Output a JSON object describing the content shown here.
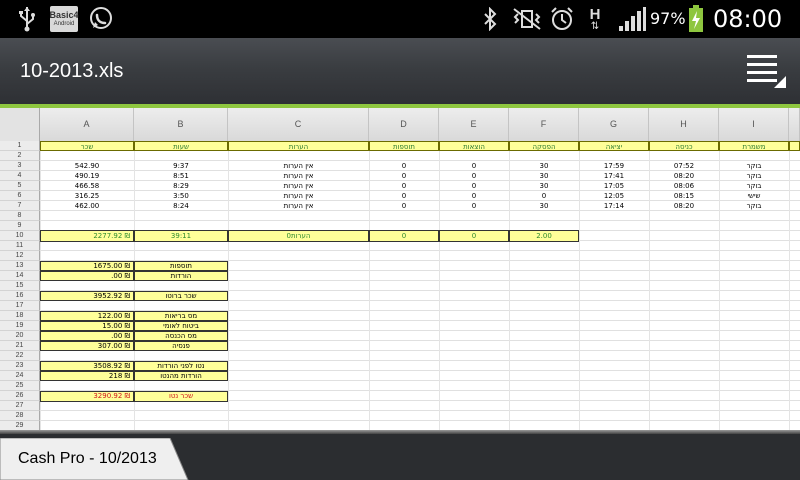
{
  "status_bar": {
    "battery_percent": "97%",
    "time": "08:00",
    "network_label": "H",
    "notification_icons": [
      "usb-icon",
      "basic-android-app-icon",
      "whatsapp-icon"
    ],
    "system_icons": [
      "bluetooth-icon",
      "vibrate-icon",
      "alarm-icon",
      "network-h-icon",
      "signal-icon",
      "battery-charging-icon"
    ],
    "app_badge_line1": "Basic4",
    "app_badge_line2": "Android"
  },
  "action_bar": {
    "file_title": "10-2013.xls",
    "menu_icon": "menu-icon",
    "accent_color": "#8ec63f"
  },
  "sheet": {
    "columns": [
      "A",
      "B",
      "C",
      "D",
      "E",
      "F",
      "G",
      "H",
      "I"
    ],
    "row_numbers": [
      "1",
      "2",
      "3",
      "4",
      "5",
      "6",
      "7",
      "8",
      "9",
      "10",
      "11",
      "12",
      "13",
      "14",
      "15",
      "16",
      "17",
      "18",
      "19",
      "20",
      "21",
      "22",
      "23",
      "24",
      "25",
      "26",
      "27",
      "28",
      "29"
    ],
    "header_row": [
      "שכר",
      "שעות",
      "הערות",
      "תוספות",
      "הוצאות",
      "הפסקה",
      "יציאה",
      "כניסה",
      "משמרת"
    ],
    "data_rows": [
      [
        "542.90",
        "9:37",
        "אין הערות",
        "0",
        "0",
        "30",
        "17:59",
        "07:52",
        "בוקר"
      ],
      [
        "490.19",
        "8:51",
        "אין הערות",
        "0",
        "0",
        "30",
        "17:41",
        "08:20",
        "בוקר"
      ],
      [
        "466.58",
        "8:29",
        "אין הערות",
        "0",
        "0",
        "30",
        "17:05",
        "08:06",
        "בוקר"
      ],
      [
        "316.25",
        "3:50",
        "אין הערות",
        "0",
        "0",
        "0",
        "12:05",
        "08:15",
        "שישי"
      ],
      [
        "462.00",
        "8:24",
        "אין הערות",
        "0",
        "0",
        "30",
        "17:14",
        "08:20",
        "בוקר"
      ]
    ],
    "totals_row": [
      "2277.92 ₪",
      "39:11",
      "0הערות",
      "0",
      "0",
      "2.00"
    ],
    "summary": [
      {
        "row": "13",
        "value": "1675.00 ₪",
        "label": "תוספות"
      },
      {
        "row": "14",
        "value": ".00 ₪",
        "label": "הורדות"
      },
      {
        "row": "16",
        "value": "3952.92 ₪",
        "label": "שכר ברוטו"
      },
      {
        "row": "18",
        "value": "122.00 ₪",
        "label": "מס בריאות"
      },
      {
        "row": "19",
        "value": "15.00 ₪",
        "label": "ביטוח לאומי"
      },
      {
        "row": "20",
        "value": ".00 ₪",
        "label": "מס הכנסה"
      },
      {
        "row": "21",
        "value": "307.00 ₪",
        "label": "פנסיה"
      },
      {
        "row": "23",
        "value": "3508.92 ₪",
        "label": "נטו לפני הורדות"
      },
      {
        "row": "24",
        "value": "218 ₪",
        "label": "הורדות מהנטו"
      },
      {
        "row": "26",
        "value": "3290.92 ₪",
        "label": "שכר נטו"
      }
    ]
  },
  "bottom": {
    "sheet_tab_label": "Cash Pro - 10/2013"
  }
}
